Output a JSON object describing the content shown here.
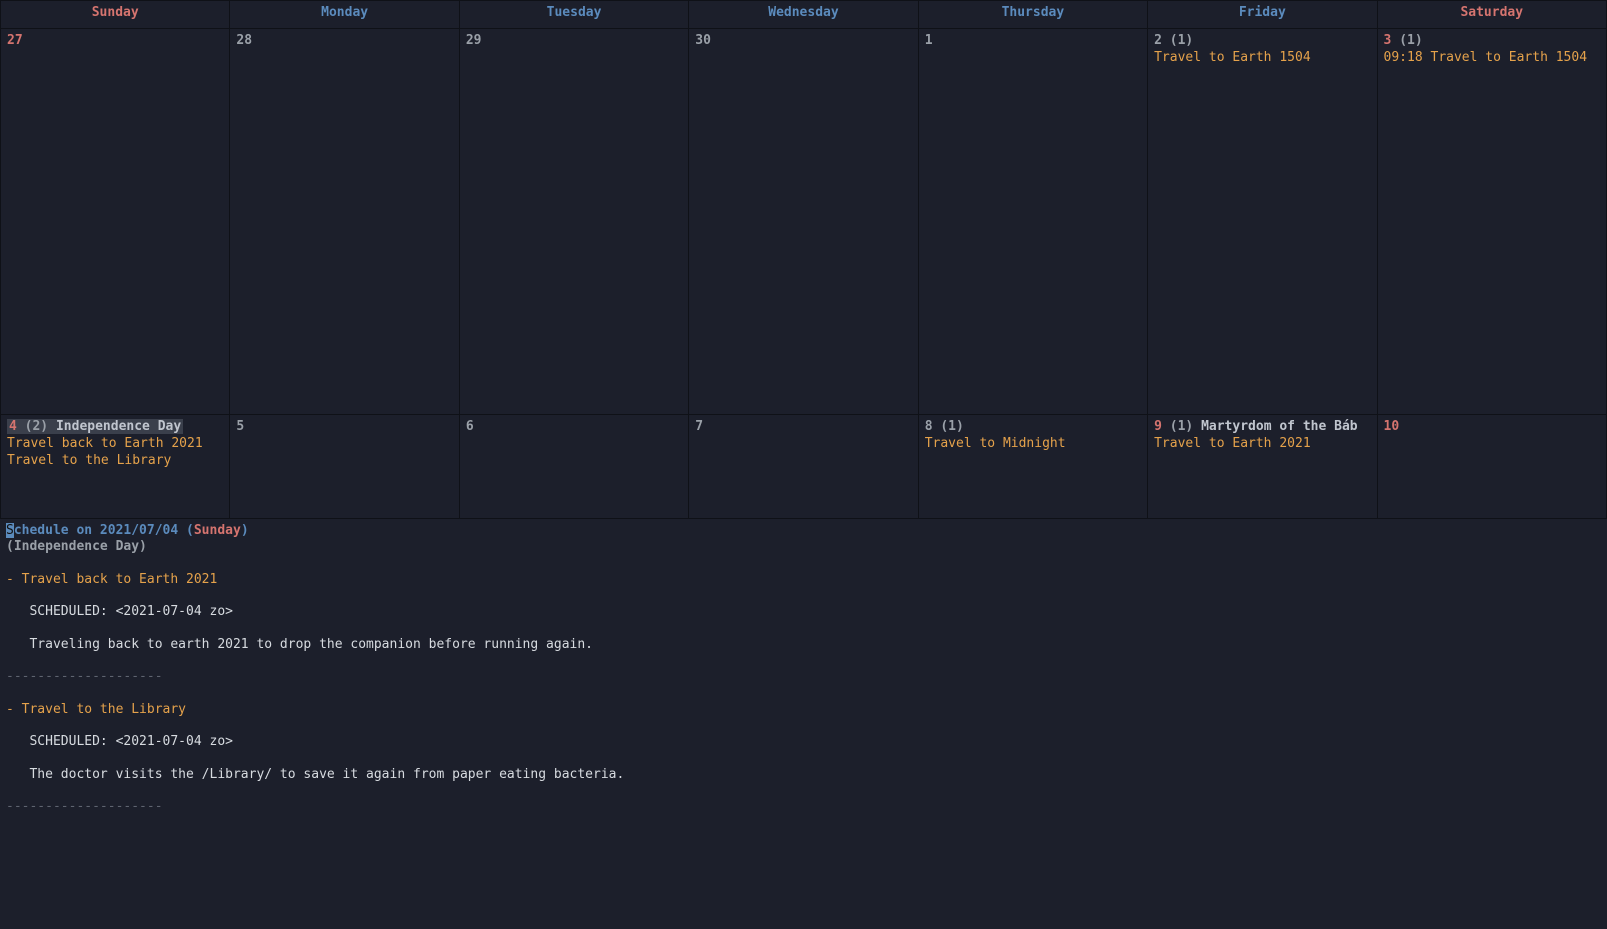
{
  "headers": {
    "sun": "Sunday",
    "mon": "Monday",
    "tue": "Tuesday",
    "wed": "Wednesday",
    "thu": "Thursday",
    "fri": "Friday",
    "sat": "Saturday"
  },
  "week1": {
    "sun": {
      "num": "27"
    },
    "mon": {
      "num": "28"
    },
    "tue": {
      "num": "29"
    },
    "wed": {
      "num": "30"
    },
    "thu": {
      "num": "1"
    },
    "fri": {
      "num": "2",
      "count": "(1)",
      "events": [
        "Travel to Earth 1504"
      ]
    },
    "sat": {
      "num": "3",
      "count": "(1)",
      "events": [
        "09:18 Travel to Earth 1504"
      ]
    }
  },
  "week2": {
    "sun": {
      "num": "4",
      "count": "(2)",
      "holiday": "Independence Day",
      "events": [
        "Travel back to Earth 2021",
        "Travel to the Library"
      ]
    },
    "mon": {
      "num": "5"
    },
    "tue": {
      "num": "6"
    },
    "wed": {
      "num": "7"
    },
    "thu": {
      "num": "8",
      "count": "(1)",
      "events": [
        "Travel to Midnight"
      ]
    },
    "fri": {
      "num": "9",
      "count": "(1)",
      "holiday": "Martyrdom of the Báb",
      "events": [
        "Travel to Earth 2021"
      ]
    },
    "sat": {
      "num": "10"
    }
  },
  "schedule": {
    "head_prefix_S": "S",
    "head_rest": "chedule on 2021/07/04 (",
    "head_day": "Sunday",
    "head_close": ")",
    "holiday_line": "(Independence Day)",
    "item1_title": "- Travel back to Earth 2021",
    "item1_sched": "   SCHEDULED: <2021-07-04 zo>",
    "item1_body": "   Traveling back to earth 2021 to drop the companion before running again.",
    "sep": "--------------------",
    "item2_title": "- Travel to the Library",
    "item2_sched": "   SCHEDULED: <2021-07-04 zo>",
    "item2_body": "   The doctor visits the /Library/ to save it again from paper eating bacteria."
  }
}
